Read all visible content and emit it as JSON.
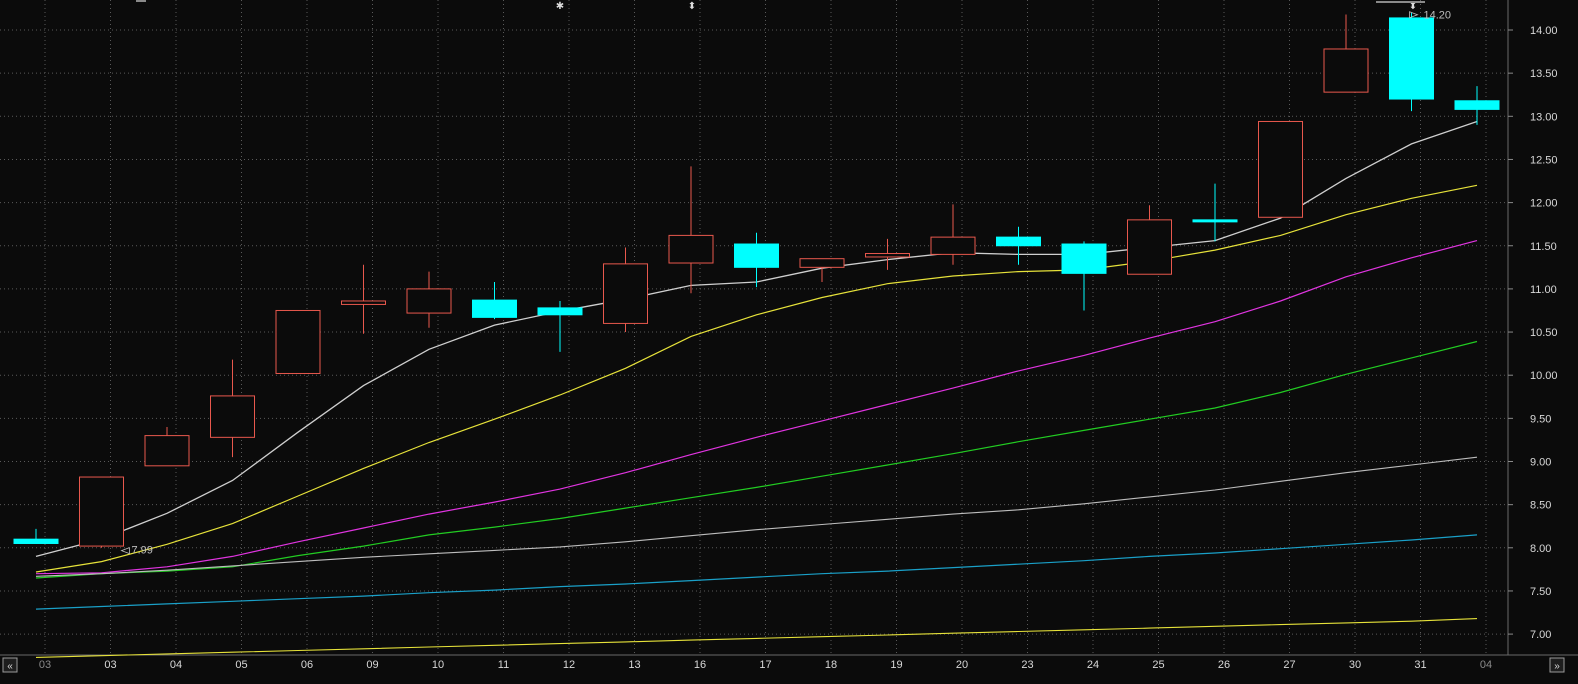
{
  "chart_data": {
    "type": "candlestick",
    "ylim": [
      6.75,
      14.25
    ],
    "y_ticks": [
      "14.00",
      "13.50",
      "13.00",
      "12.50",
      "12.00",
      "11.50",
      "11.00",
      "10.50",
      "10.00",
      "9.50",
      "9.00",
      "8.50",
      "8.00",
      "7.50",
      "7.00"
    ],
    "y_tick_values": [
      14.0,
      13.5,
      13.0,
      12.5,
      12.0,
      11.5,
      11.0,
      10.5,
      10.0,
      9.5,
      9.0,
      8.5,
      8.0,
      7.5,
      7.0
    ],
    "grid": true,
    "categories": [
      "03",
      "03",
      "04",
      "05",
      "06",
      "09",
      "10",
      "11",
      "12",
      "13",
      "16",
      "17",
      "18",
      "19",
      "20",
      "23",
      "24",
      "25",
      "26",
      "27",
      "30",
      "31",
      "04"
    ],
    "first_label_dim": true,
    "last_label_dim": true,
    "candles": [
      {
        "open": 8.05,
        "high": 8.22,
        "low": 8.05,
        "close": 8.1,
        "dir": "down"
      },
      {
        "open": 8.02,
        "high": 8.82,
        "low": 8.0,
        "close": 8.82,
        "dir": "up"
      },
      {
        "open": 8.95,
        "high": 9.4,
        "low": 8.95,
        "close": 9.3,
        "dir": "up"
      },
      {
        "open": 9.28,
        "high": 10.18,
        "low": 9.05,
        "close": 9.76,
        "dir": "up"
      },
      {
        "open": 10.02,
        "high": 10.75,
        "low": 10.02,
        "close": 10.75,
        "dir": "up"
      },
      {
        "open": 10.82,
        "high": 11.28,
        "low": 10.48,
        "close": 10.86,
        "dir": "up"
      },
      {
        "open": 10.72,
        "high": 11.2,
        "low": 10.55,
        "close": 11.0,
        "dir": "up"
      },
      {
        "open": 10.87,
        "high": 11.08,
        "low": 10.65,
        "close": 10.67,
        "dir": "down"
      },
      {
        "open": 10.78,
        "high": 10.86,
        "low": 10.27,
        "close": 10.7,
        "dir": "down"
      },
      {
        "open": 10.6,
        "high": 11.48,
        "low": 10.5,
        "close": 11.29,
        "dir": "up"
      },
      {
        "open": 11.3,
        "high": 12.42,
        "low": 10.95,
        "close": 11.62,
        "dir": "up"
      },
      {
        "open": 11.52,
        "high": 11.65,
        "low": 11.02,
        "close": 11.25,
        "dir": "down"
      },
      {
        "open": 11.25,
        "high": 11.35,
        "low": 11.08,
        "close": 11.35,
        "dir": "up"
      },
      {
        "open": 11.37,
        "high": 11.58,
        "low": 11.22,
        "close": 11.41,
        "dir": "up"
      },
      {
        "open": 11.4,
        "high": 11.98,
        "low": 11.28,
        "close": 11.6,
        "dir": "up"
      },
      {
        "open": 11.6,
        "high": 11.72,
        "low": 11.28,
        "close": 11.5,
        "dir": "down"
      },
      {
        "open": 11.52,
        "high": 11.55,
        "low": 10.75,
        "close": 11.18,
        "dir": "down"
      },
      {
        "open": 11.17,
        "high": 11.97,
        "low": 11.17,
        "close": 11.8,
        "dir": "up"
      },
      {
        "open": 11.8,
        "high": 12.22,
        "low": 11.55,
        "close": 11.78,
        "dir": "down"
      },
      {
        "open": 11.83,
        "high": 12.94,
        "low": 11.83,
        "close": 12.94,
        "dir": "up"
      },
      {
        "open": 13.28,
        "high": 14.18,
        "low": 13.28,
        "close": 13.78,
        "dir": "up"
      },
      {
        "open": 14.14,
        "high": 14.2,
        "low": 13.06,
        "close": 13.2,
        "dir": "down"
      },
      {
        "open": 13.18,
        "high": 13.35,
        "low": 12.9,
        "close": 13.08,
        "dir": "down"
      }
    ],
    "series": [
      {
        "color": "#cfcfcf",
        "width": 1.3,
        "values": [
          7.9,
          8.1,
          8.4,
          8.78,
          9.34,
          9.88,
          10.3,
          10.58,
          10.74,
          10.88,
          11.04,
          11.08,
          11.24,
          11.34,
          11.42,
          11.4,
          11.4,
          11.48,
          11.56,
          11.82,
          12.28,
          12.68,
          12.94
        ]
      },
      {
        "color": "#e6e23a",
        "width": 1.2,
        "values": [
          7.72,
          7.84,
          8.04,
          8.28,
          8.6,
          8.92,
          9.22,
          9.49,
          9.77,
          10.08,
          10.45,
          10.7,
          10.9,
          11.06,
          11.15,
          11.2,
          11.22,
          11.32,
          11.45,
          11.62,
          11.86,
          12.05,
          12.2
        ]
      },
      {
        "color": "#e034e0",
        "width": 1.2,
        "values": [
          7.7,
          7.71,
          7.78,
          7.9,
          8.07,
          8.23,
          8.39,
          8.53,
          8.68,
          8.87,
          9.08,
          9.28,
          9.47,
          9.66,
          9.85,
          10.05,
          10.23,
          10.43,
          10.62,
          10.86,
          11.14,
          11.36,
          11.56
        ]
      },
      {
        "color": "#22cc22",
        "width": 1.2,
        "values": [
          7.65,
          7.7,
          7.73,
          7.78,
          7.91,
          8.02,
          8.15,
          8.24,
          8.34,
          8.46,
          8.58,
          8.7,
          8.83,
          8.96,
          9.09,
          9.23,
          9.36,
          9.49,
          9.62,
          9.8,
          10.01,
          10.2,
          10.39
        ]
      },
      {
        "color": "#bdbdbd",
        "width": 1.1,
        "values": [
          7.67,
          7.7,
          7.74,
          7.79,
          7.84,
          7.89,
          7.93,
          7.97,
          8.01,
          8.07,
          8.14,
          8.21,
          8.27,
          8.33,
          8.39,
          8.44,
          8.51,
          8.59,
          8.67,
          8.77,
          8.87,
          8.96,
          9.05
        ]
      },
      {
        "color": "#1aa0c8",
        "width": 1.2,
        "values": [
          7.29,
          7.32,
          7.35,
          7.38,
          7.41,
          7.44,
          7.48,
          7.51,
          7.55,
          7.58,
          7.62,
          7.66,
          7.7,
          7.73,
          7.77,
          7.81,
          7.85,
          7.9,
          7.94,
          7.99,
          8.04,
          8.09,
          8.15
        ]
      },
      {
        "color": "#e6e23a",
        "width": 1.1,
        "values": [
          6.73,
          6.75,
          6.77,
          6.79,
          6.81,
          6.83,
          6.85,
          6.87,
          6.89,
          6.91,
          6.93,
          6.95,
          6.97,
          6.99,
          7.01,
          7.03,
          7.05,
          7.07,
          7.09,
          7.11,
          7.13,
          7.15,
          7.18
        ]
      }
    ],
    "annotations": [
      {
        "text": "7.99",
        "value": 7.99,
        "index": 1,
        "kind": "low-marker"
      },
      {
        "text": "14.20",
        "value": 14.2,
        "index": 21,
        "kind": "high-marker"
      }
    ],
    "top_markers": [
      {
        "glyph": "✱",
        "index": 12
      },
      {
        "glyph": "⬍",
        "index": 15
      },
      {
        "glyph": "⬍",
        "index": 32
      }
    ],
    "colors": {
      "up_candle": "#e8584d",
      "down_candle": "#00ffff",
      "grid": "#5a5a5a",
      "background": "#0b0b0b",
      "axis_text": "#d8d8d8",
      "annotation": "#bdbdbd"
    }
  },
  "nav": {
    "left_button_icon": "double-chevron-left-icon",
    "right_button_icon": "double-chevron-right-icon",
    "left_glyph": "«",
    "right_glyph": "»"
  }
}
